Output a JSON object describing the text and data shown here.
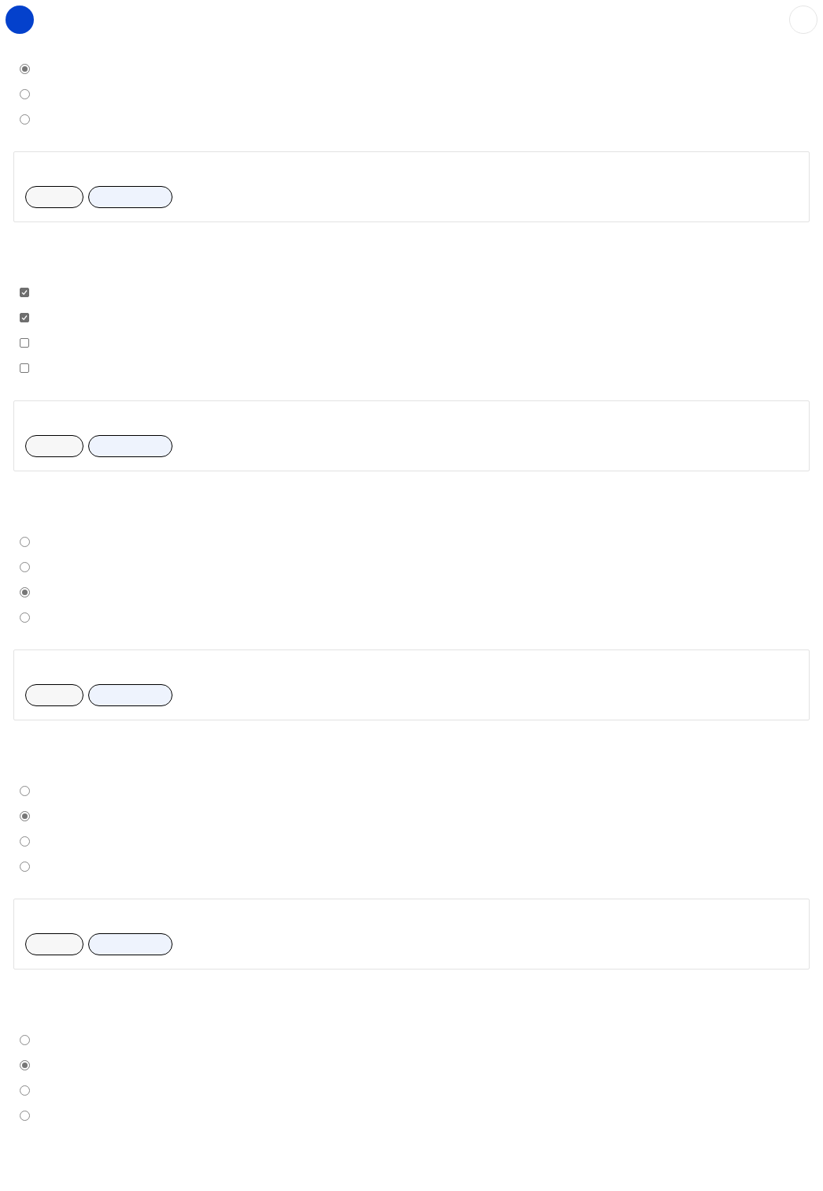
{
  "questions": [
    {
      "kind": "radio",
      "options": [
        {
          "selected": true
        },
        {
          "selected": false
        },
        {
          "selected": false
        }
      ]
    },
    {
      "kind": "checkbox",
      "options": [
        {
          "checked": true
        },
        {
          "checked": true
        },
        {
          "checked": false
        },
        {
          "checked": false
        }
      ]
    },
    {
      "kind": "radio",
      "options": [
        {
          "selected": false
        },
        {
          "selected": false
        },
        {
          "selected": true
        },
        {
          "selected": false
        }
      ]
    },
    {
      "kind": "radio",
      "options": [
        {
          "selected": false
        },
        {
          "selected": true
        },
        {
          "selected": false
        },
        {
          "selected": false
        }
      ]
    },
    {
      "kind": "radio",
      "options": [
        {
          "selected": false
        },
        {
          "selected": true
        },
        {
          "selected": false
        },
        {
          "selected": false
        }
      ]
    }
  ]
}
